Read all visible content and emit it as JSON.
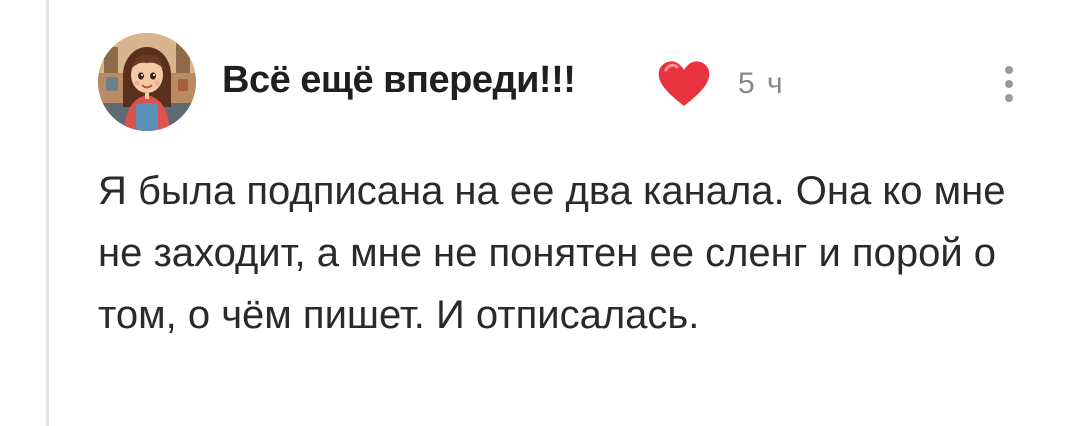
{
  "comment": {
    "author": "Всё ещё впереди!!!",
    "author_emoji_icon": "red-heart-icon",
    "time": "5 ч",
    "more_icon": "kebab-menu-icon",
    "text": "Я была подписана на ее два канала. Она ко мне не заходит, а мне не понятен ее сленг и порой о том, о чём пишет. И отписалась.",
    "avatar_icon": "cartoon-girl-avatar"
  },
  "colors": {
    "heart": "#e8333f",
    "time_text": "#888888",
    "body_text": "#2a2a2a",
    "thread_line": "#e3e3e3"
  }
}
